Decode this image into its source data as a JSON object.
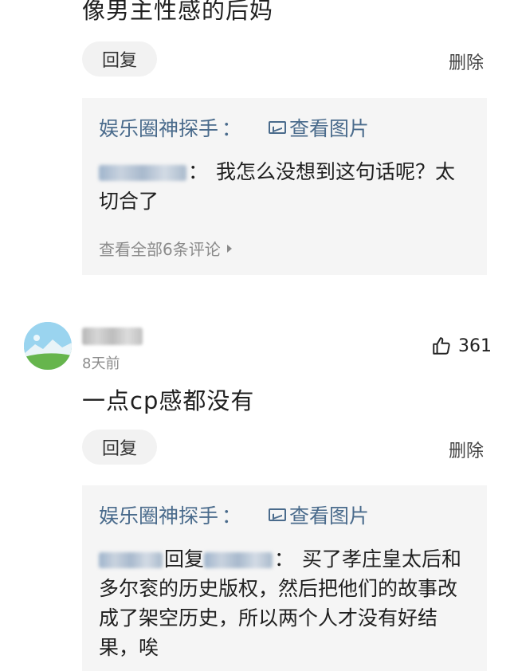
{
  "comment_1": {
    "text": "像男主性感的后妈",
    "reply_label": "回复",
    "delete_label": "删除",
    "sub": {
      "author": "娱乐圈神探手",
      "colon": "：",
      "view_image_label": "查看图片",
      "reply_colon": "：",
      "reply_text": "我怎么没想到这句话呢？太切合了",
      "view_all_label": "查看全部6条评论"
    }
  },
  "comment_2": {
    "time": "8天前",
    "likes": "361",
    "text": "一点cp感都没有",
    "reply_label": "回复",
    "delete_label": "删除",
    "sub": {
      "author": "娱乐圈神探手",
      "colon": "：",
      "view_image_label": "查看图片",
      "reply_verb": "回复",
      "reply_colon": "：",
      "reply_text": "买了孝庄皇太后和多尔衮的历史版权，然后把他们的故事改成了架空历史，所以两个人才没有好结果，唉"
    }
  },
  "icons": {
    "image": "image-icon",
    "like": "thumbs-up-icon",
    "arrow": "triangle-right-icon"
  },
  "colors": {
    "link_blue": "#4a6b8c",
    "sub_bg": "#f5f5f5",
    "reply_btn_bg": "#f2f2f2"
  }
}
